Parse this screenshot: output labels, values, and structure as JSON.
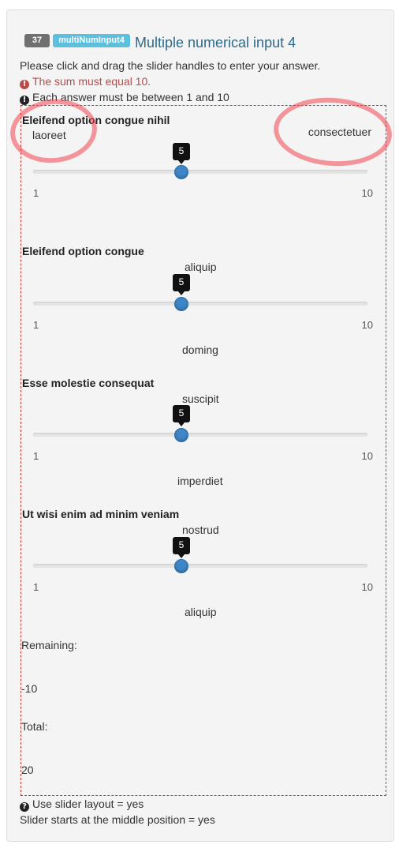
{
  "header": {
    "question_number": "37",
    "question_type": "multiNumInput4",
    "title": "Multiple numerical input 4"
  },
  "instructions": {
    "main": "Please click and drag the slider handles to enter your answer.",
    "sum_error": "The sum must equal 10.",
    "range_note": "Each answer must be between 1 and 10"
  },
  "sliders": [
    {
      "label": "Eleifend option congue nihil",
      "left_text": "laoreet",
      "right_text": "consectetuer",
      "value": "5",
      "min": "1",
      "max": "10"
    },
    {
      "label": "Eleifend option congue",
      "top_text": "aliquip",
      "bottom_text": "doming",
      "value": "5",
      "min": "1",
      "max": "10"
    },
    {
      "label": "Esse molestie consequat",
      "top_text": "suscipit",
      "bottom_text": "imperdiet",
      "value": "5",
      "min": "1",
      "max": "10"
    },
    {
      "label": "Ut wisi enim ad minim veniam",
      "top_text": "nostrud",
      "bottom_text": "aliquip",
      "value": "5",
      "min": "1",
      "max": "10"
    }
  ],
  "summary": {
    "remaining_label": "Remaining:",
    "remaining_value": "-10",
    "total_label": "Total:",
    "total_value": "20"
  },
  "footer": {
    "layout_note": "Use slider layout = yes",
    "start_note": "Slider starts at the middle position = yes"
  },
  "colors": {
    "accent": "#3f86c8",
    "error": "#b94a48",
    "title": "#2b6a8c"
  },
  "icons": {
    "error": "exclamation-circle-icon",
    "info": "exclamation-circle-icon",
    "help": "question-circle-icon"
  }
}
